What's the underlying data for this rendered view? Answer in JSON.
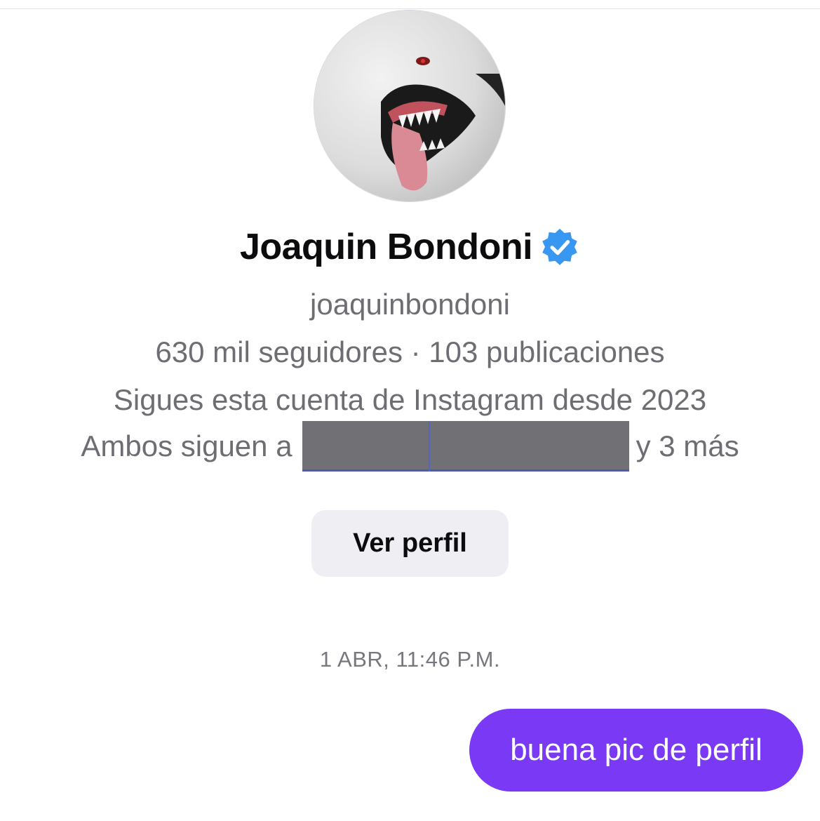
{
  "profile": {
    "name": "Joaquin Bondoni",
    "username": "joaquinbondoni",
    "stats": "630 mil seguidores · 103 publicaciones",
    "follow_since": "Sigues esta cuenta de Instagram desde 2023",
    "mutual_prefix": "Ambos siguen a",
    "mutual_suffix": "y 3 más",
    "avatar_icon": "profile-photo",
    "verified_icon": "verified-badge-icon",
    "verified_color": "#3897f0"
  },
  "actions": {
    "view_profile_label": "Ver perfil"
  },
  "conversation": {
    "timestamp": "1 ABR, 11:46 P.M.",
    "messages": [
      {
        "text": "buena pic de perfil",
        "sender": "me",
        "color": "#7a39f4"
      }
    ]
  }
}
